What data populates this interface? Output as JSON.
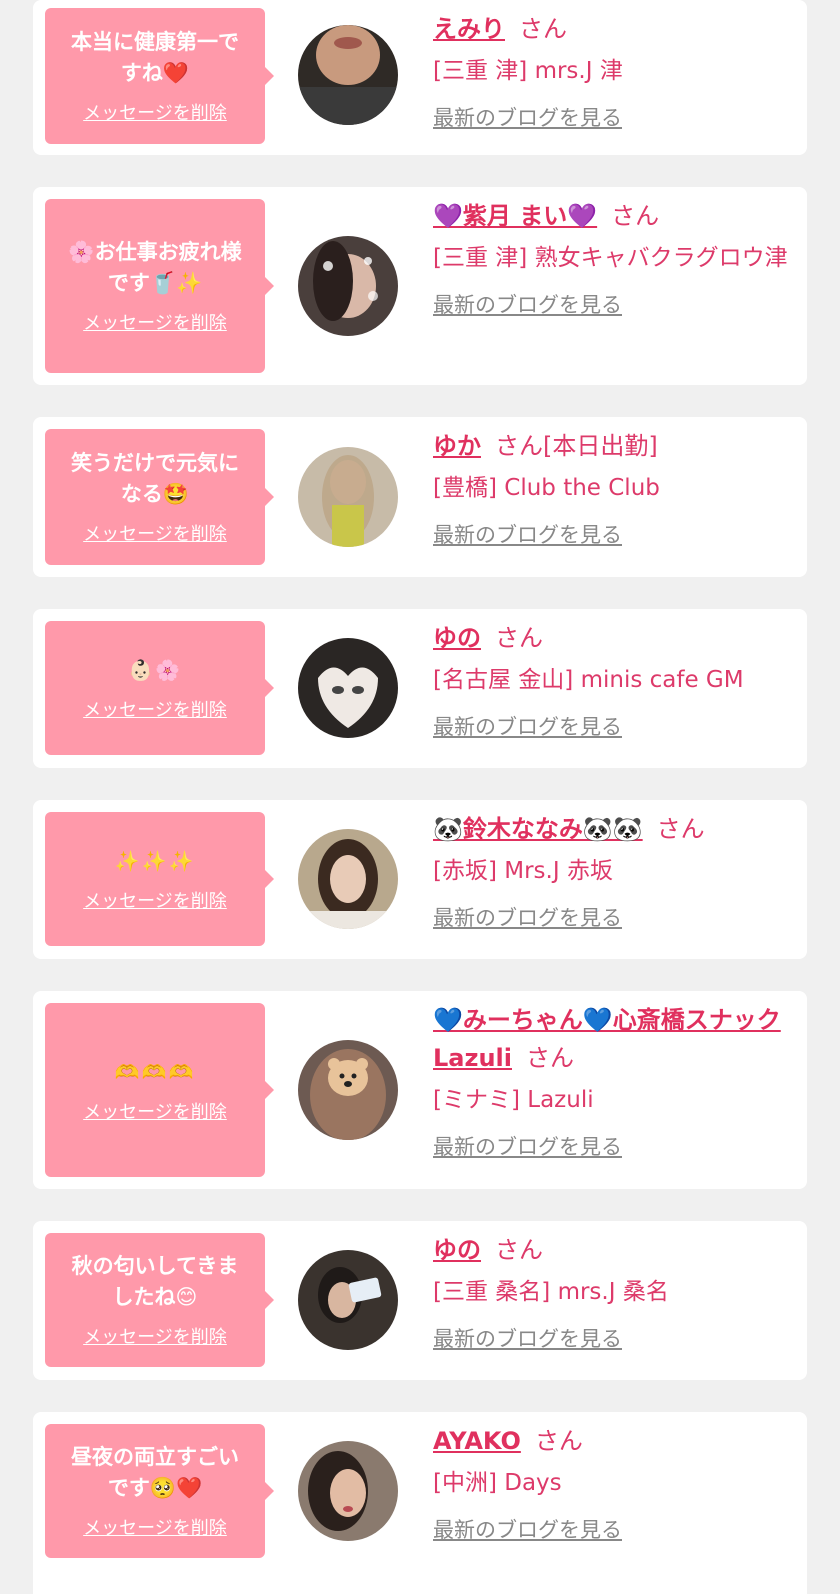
{
  "delete_label": "メッセージを削除",
  "blog_label": "最新のブログを見る",
  "san": "さん",
  "cards": [
    {
      "message": "本当に健康第一で\nすね❤️",
      "name": "えみり",
      "suffix": "",
      "shop": "[三重 津] mrs.J 津"
    },
    {
      "message": "🌸お仕事お疲れ様\nです🥤✨",
      "name": "💜紫月 まい💜",
      "suffix": "",
      "shop": "[三重 津] 熟女キャバクラグロウ津"
    },
    {
      "message": "笑うだけで元気に\nなる🤩",
      "name": "ゆか",
      "suffix": "[本日出勤]",
      "shop": "[豊橋] Club the Club"
    },
    {
      "message": "👶🏻🌸",
      "name": "ゆの",
      "suffix": "",
      "shop": "[名古屋 金山] minis cafe GM"
    },
    {
      "message": "✨✨✨",
      "name": "🐼鈴木ななみ🐼🐼",
      "suffix": "",
      "shop": "[赤坂] Mrs.J 赤坂"
    },
    {
      "message": "🫶🫶🫶",
      "name": "💙みーちゃん💙心斎橋スナックLazuli",
      "suffix": "",
      "shop": "[ミナミ] Lazuli"
    },
    {
      "message": "秋の匂いしてきま\nしたね😊",
      "name": "ゆの",
      "suffix": "",
      "shop": "[三重 桑名] mrs.J 桑名"
    },
    {
      "message": "昼夜の両立すごい\nです🥺❤️",
      "name": "AYAKO",
      "suffix": "",
      "shop": "[中洲] Days"
    }
  ],
  "colors": {
    "bubble": "#ff99aa",
    "name": "#e0305e",
    "text": "#dd3a6a",
    "link_gray": "#888888",
    "background": "#f0f0f0"
  }
}
